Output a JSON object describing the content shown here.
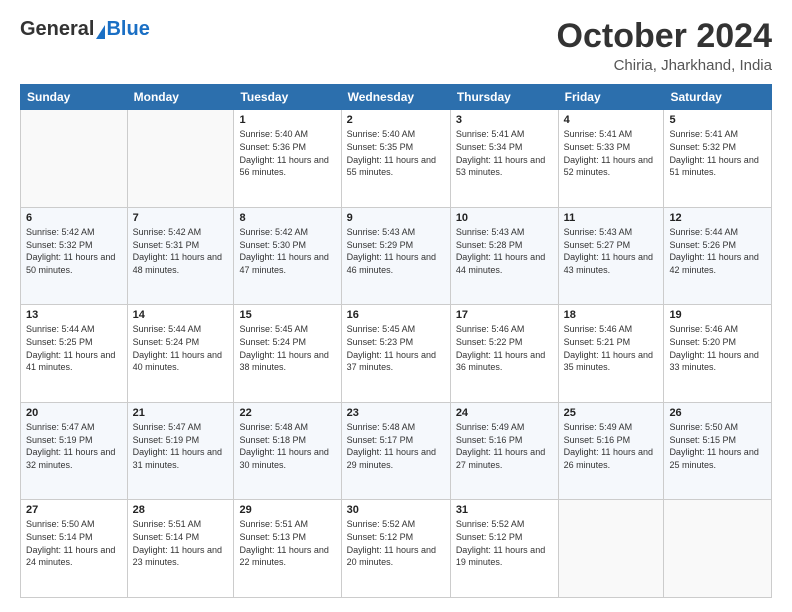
{
  "header": {
    "logo_general": "General",
    "logo_blue": "Blue",
    "month_title": "October 2024",
    "location": "Chiria, Jharkhand, India"
  },
  "days_of_week": [
    "Sunday",
    "Monday",
    "Tuesday",
    "Wednesday",
    "Thursday",
    "Friday",
    "Saturday"
  ],
  "weeks": [
    [
      {
        "day": "",
        "info": ""
      },
      {
        "day": "",
        "info": ""
      },
      {
        "day": "1",
        "info": "Sunrise: 5:40 AM\nSunset: 5:36 PM\nDaylight: 11 hours and 56 minutes."
      },
      {
        "day": "2",
        "info": "Sunrise: 5:40 AM\nSunset: 5:35 PM\nDaylight: 11 hours and 55 minutes."
      },
      {
        "day": "3",
        "info": "Sunrise: 5:41 AM\nSunset: 5:34 PM\nDaylight: 11 hours and 53 minutes."
      },
      {
        "day": "4",
        "info": "Sunrise: 5:41 AM\nSunset: 5:33 PM\nDaylight: 11 hours and 52 minutes."
      },
      {
        "day": "5",
        "info": "Sunrise: 5:41 AM\nSunset: 5:32 PM\nDaylight: 11 hours and 51 minutes."
      }
    ],
    [
      {
        "day": "6",
        "info": "Sunrise: 5:42 AM\nSunset: 5:32 PM\nDaylight: 11 hours and 50 minutes."
      },
      {
        "day": "7",
        "info": "Sunrise: 5:42 AM\nSunset: 5:31 PM\nDaylight: 11 hours and 48 minutes."
      },
      {
        "day": "8",
        "info": "Sunrise: 5:42 AM\nSunset: 5:30 PM\nDaylight: 11 hours and 47 minutes."
      },
      {
        "day": "9",
        "info": "Sunrise: 5:43 AM\nSunset: 5:29 PM\nDaylight: 11 hours and 46 minutes."
      },
      {
        "day": "10",
        "info": "Sunrise: 5:43 AM\nSunset: 5:28 PM\nDaylight: 11 hours and 44 minutes."
      },
      {
        "day": "11",
        "info": "Sunrise: 5:43 AM\nSunset: 5:27 PM\nDaylight: 11 hours and 43 minutes."
      },
      {
        "day": "12",
        "info": "Sunrise: 5:44 AM\nSunset: 5:26 PM\nDaylight: 11 hours and 42 minutes."
      }
    ],
    [
      {
        "day": "13",
        "info": "Sunrise: 5:44 AM\nSunset: 5:25 PM\nDaylight: 11 hours and 41 minutes."
      },
      {
        "day": "14",
        "info": "Sunrise: 5:44 AM\nSunset: 5:24 PM\nDaylight: 11 hours and 40 minutes."
      },
      {
        "day": "15",
        "info": "Sunrise: 5:45 AM\nSunset: 5:24 PM\nDaylight: 11 hours and 38 minutes."
      },
      {
        "day": "16",
        "info": "Sunrise: 5:45 AM\nSunset: 5:23 PM\nDaylight: 11 hours and 37 minutes."
      },
      {
        "day": "17",
        "info": "Sunrise: 5:46 AM\nSunset: 5:22 PM\nDaylight: 11 hours and 36 minutes."
      },
      {
        "day": "18",
        "info": "Sunrise: 5:46 AM\nSunset: 5:21 PM\nDaylight: 11 hours and 35 minutes."
      },
      {
        "day": "19",
        "info": "Sunrise: 5:46 AM\nSunset: 5:20 PM\nDaylight: 11 hours and 33 minutes."
      }
    ],
    [
      {
        "day": "20",
        "info": "Sunrise: 5:47 AM\nSunset: 5:19 PM\nDaylight: 11 hours and 32 minutes."
      },
      {
        "day": "21",
        "info": "Sunrise: 5:47 AM\nSunset: 5:19 PM\nDaylight: 11 hours and 31 minutes."
      },
      {
        "day": "22",
        "info": "Sunrise: 5:48 AM\nSunset: 5:18 PM\nDaylight: 11 hours and 30 minutes."
      },
      {
        "day": "23",
        "info": "Sunrise: 5:48 AM\nSunset: 5:17 PM\nDaylight: 11 hours and 29 minutes."
      },
      {
        "day": "24",
        "info": "Sunrise: 5:49 AM\nSunset: 5:16 PM\nDaylight: 11 hours and 27 minutes."
      },
      {
        "day": "25",
        "info": "Sunrise: 5:49 AM\nSunset: 5:16 PM\nDaylight: 11 hours and 26 minutes."
      },
      {
        "day": "26",
        "info": "Sunrise: 5:50 AM\nSunset: 5:15 PM\nDaylight: 11 hours and 25 minutes."
      }
    ],
    [
      {
        "day": "27",
        "info": "Sunrise: 5:50 AM\nSunset: 5:14 PM\nDaylight: 11 hours and 24 minutes."
      },
      {
        "day": "28",
        "info": "Sunrise: 5:51 AM\nSunset: 5:14 PM\nDaylight: 11 hours and 23 minutes."
      },
      {
        "day": "29",
        "info": "Sunrise: 5:51 AM\nSunset: 5:13 PM\nDaylight: 11 hours and 22 minutes."
      },
      {
        "day": "30",
        "info": "Sunrise: 5:52 AM\nSunset: 5:12 PM\nDaylight: 11 hours and 20 minutes."
      },
      {
        "day": "31",
        "info": "Sunrise: 5:52 AM\nSunset: 5:12 PM\nDaylight: 11 hours and 19 minutes."
      },
      {
        "day": "",
        "info": ""
      },
      {
        "day": "",
        "info": ""
      }
    ]
  ]
}
